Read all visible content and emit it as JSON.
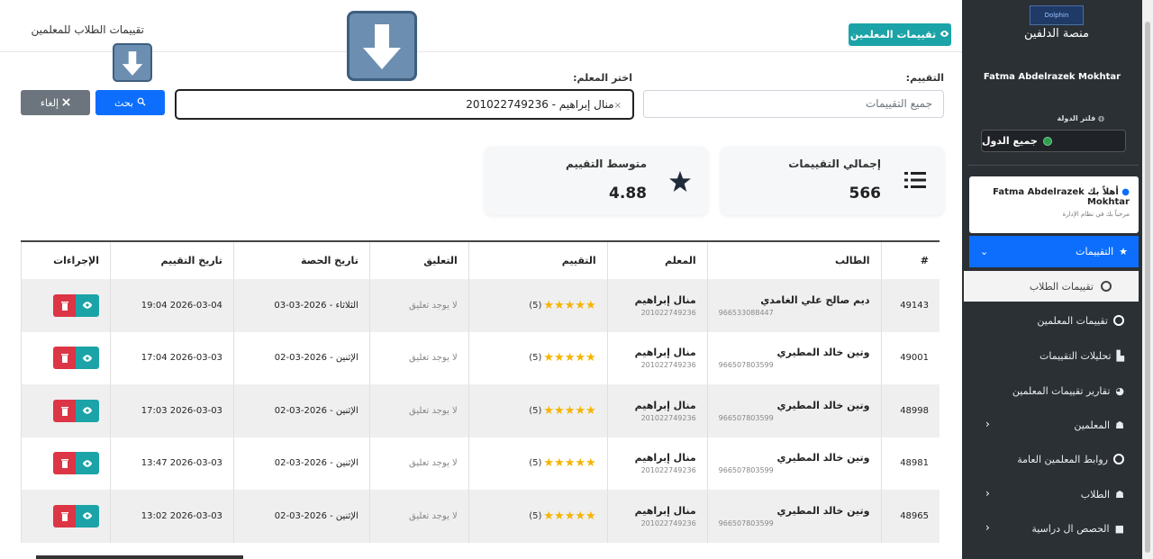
{
  "header": {
    "page_title": "تقييمات الطلاب للمعلمين",
    "teacher_ratings_button": "تقييمات المعلمين"
  },
  "filters": {
    "rating_label": "التقييم:",
    "rating_value": "جميع التقييمات",
    "teacher_label": "اختر المعلم:",
    "teacher_value": "منال إبراهيم - 201022749236",
    "teacher_clear": "×",
    "search_button": "بحث",
    "cancel_button": "إلغاء"
  },
  "stats": {
    "total_label": "إجمالي التقييمات",
    "total_value": "566",
    "avg_label": "متوسط التقييم",
    "avg_value": "4.88"
  },
  "table": {
    "headers": {
      "num": "#",
      "student": "الطالب",
      "teacher": "المعلم",
      "rating": "التقييم",
      "comment": "التعليق",
      "session_date": "تاريخ الحصة",
      "rating_date": "تاريخ التقييم",
      "actions": "الإجراءات"
    },
    "rows": [
      {
        "id": "49143",
        "student": "ديم صالح علي الغامدي",
        "student_phone": "966533088447",
        "teacher": "منال إبراهيم",
        "teacher_phone": "201022749236",
        "stars": 5,
        "rating_text": "(5)",
        "comment": "لا يوجد تعليق",
        "session_date": "الثلاثاء - 2026-03-03",
        "rating_date": "2026-03-04 19:04"
      },
      {
        "id": "49001",
        "student": "وتين خالد المطيري",
        "student_phone": "966507803599",
        "teacher": "منال إبراهيم",
        "teacher_phone": "201022749236",
        "stars": 5,
        "rating_text": "(5)",
        "comment": "لا يوجد تعليق",
        "session_date": "الإثنين - 2026-03-02",
        "rating_date": "2026-03-03 17:04"
      },
      {
        "id": "48998",
        "student": "وتين خالد المطيري",
        "student_phone": "966507803599",
        "teacher": "منال إبراهيم",
        "teacher_phone": "201022749236",
        "stars": 5,
        "rating_text": "(5)",
        "comment": "لا يوجد تعليق",
        "session_date": "الإثنين - 2026-03-02",
        "rating_date": "2026-03-03 17:03"
      },
      {
        "id": "48981",
        "student": "وتين خالد المطيري",
        "student_phone": "966507803599",
        "teacher": "منال إبراهيم",
        "teacher_phone": "201022749236",
        "stars": 5,
        "rating_text": "(5)",
        "comment": "لا يوجد تعليق",
        "session_date": "الإثنين - 2026-03-02",
        "rating_date": "2026-03-03 13:47"
      },
      {
        "id": "48965",
        "student": "وتين خالد المطيري",
        "student_phone": "966507803599",
        "teacher": "منال إبراهيم",
        "teacher_phone": "201022749236",
        "stars": 5,
        "rating_text": "(5)",
        "comment": "لا يوجد تعليق",
        "session_date": "الإثنين - 2026-03-02",
        "rating_date": "2026-03-03 13:02"
      }
    ]
  },
  "sidebar": {
    "logo_text": "Dolphin",
    "brand": "منصة الدلفين",
    "user_name": "Fatma Abdelrazek Mokhtar",
    "country_filter_label": "فلتر الدولة",
    "country_filter_value": "جميع الدول",
    "welcome_title": "أهلاً بك Fatma Abdelrazek Mokhtar",
    "welcome_sub": "مرحباً بك في نظام الإدارة",
    "active_item": "التقييمات",
    "active_sub_item": "تقييمات الطلاب",
    "items": [
      {
        "label": "تقييمات المعلمين",
        "icon": "circle-icon"
      },
      {
        "label": "تحليلات التقييمات",
        "icon": "chart-icon"
      },
      {
        "label": "تقارير تقييمات المعلمين",
        "icon": "pie-icon"
      },
      {
        "label": "المعلمين",
        "icon": "teacher-icon"
      },
      {
        "label": "روابط المعلمين العامة",
        "icon": "circle-icon"
      },
      {
        "label": "الطلاب",
        "icon": "student-icon"
      },
      {
        "label": "الحصص ال دراسية",
        "icon": "video-icon"
      }
    ]
  },
  "colors": {
    "sidebar_bg": "#2b3035",
    "primary": "#0d6efd",
    "teal": "#1ba3a7",
    "danger": "#dc3545",
    "star": "#f5b400"
  }
}
